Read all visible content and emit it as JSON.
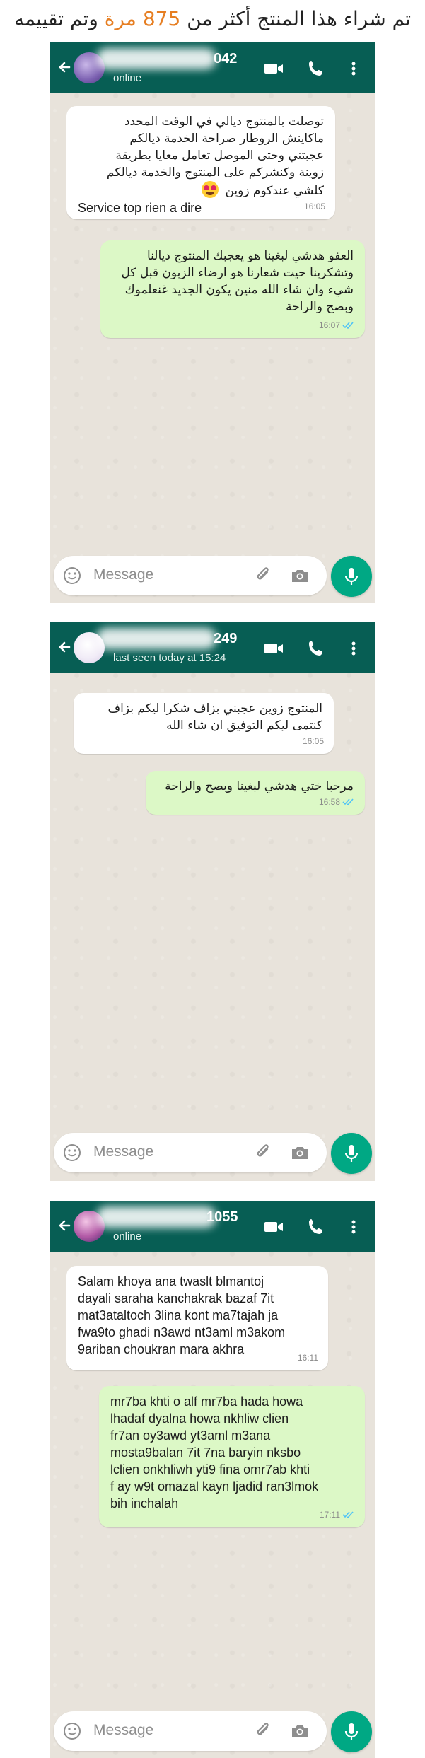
{
  "headline": {
    "prefix": "تم شراء هذا المنتج أكثر من",
    "count": "875",
    "unit": "مرة",
    "suffix": "وتم تقييمه"
  },
  "colors": {
    "header": "#075e54",
    "incoming": "#ffffff",
    "outgoing": "#dcf8c6",
    "accent": "#00a884",
    "highlight": "#e67e22"
  },
  "icons": [
    "back-arrow-icon",
    "video-call-icon",
    "voice-call-icon",
    "menu-icon",
    "emoji-icon",
    "attach-icon",
    "camera-icon",
    "mic-icon",
    "read-ticks-icon"
  ],
  "chats": [
    {
      "contact_suffix": "042",
      "status": "online",
      "messages": [
        {
          "direction": "in",
          "text": "توصلت بالمنتوج ديالي في الوقت المحدد\nماكاينش الروطار صراحة الخدمة ديالكم\nعجبتني وحتى الموصل تعامل معايا بطريقة\nزوينة وكنشركم على المنتوج والخدمة ديالكم\nكلشي عندكوم زوين",
          "text_latin": "Service top rien a dire",
          "time": "16:05"
        },
        {
          "direction": "out",
          "text": "العفو هدشي لبغينا هو يعجبك المنتوج ديالنا\nوتشكرينا حيت شعارنا هو ارضاء الزبون قبل كل\nشيء وان شاء الله منين يكون الجديد غنعلموك\nوبصح والراحة",
          "time": "16:07"
        }
      ],
      "input_placeholder": "Message"
    },
    {
      "contact_suffix": "249",
      "status": "last seen today at 15:24",
      "messages": [
        {
          "direction": "in",
          "text": "المنتوج زوين عجبني بزاف شكرا ليكم بزاف\nكنتمى ليكم التوفيق ان شاء الله",
          "time": "16:05"
        },
        {
          "direction": "out",
          "text": "مرحبا ختي هدشي لبغينا وبصح والراحة",
          "time": "16:58"
        }
      ],
      "input_placeholder": "Message"
    },
    {
      "contact_suffix": "1055",
      "status": "online",
      "messages": [
        {
          "direction": "in",
          "text": "Salam khoya ana twaslt blmantoj\ndayali saraha kanchakrak bazaf 7it\nmat3ataltoch 3lina kont ma7tajah ja\nfwa9to ghadi n3awd nt3aml m3akom\n9ariban choukran mara akhra",
          "time": "16:11"
        },
        {
          "direction": "out",
          "text": "mr7ba khti o alf mr7ba hada howa\nlhadaf dyalna howa nkhliw clien\nfr7an oy3awd yt3aml m3ana\nmosta9balan 7it 7na baryin nksbo\nlclien onkhliwh yti9 fina omr7ab khti\nf ay w9t omazal kayn ljadid ran3lmok\nbih inchalah",
          "time": "17:11"
        }
      ],
      "input_placeholder": "Message"
    }
  ]
}
